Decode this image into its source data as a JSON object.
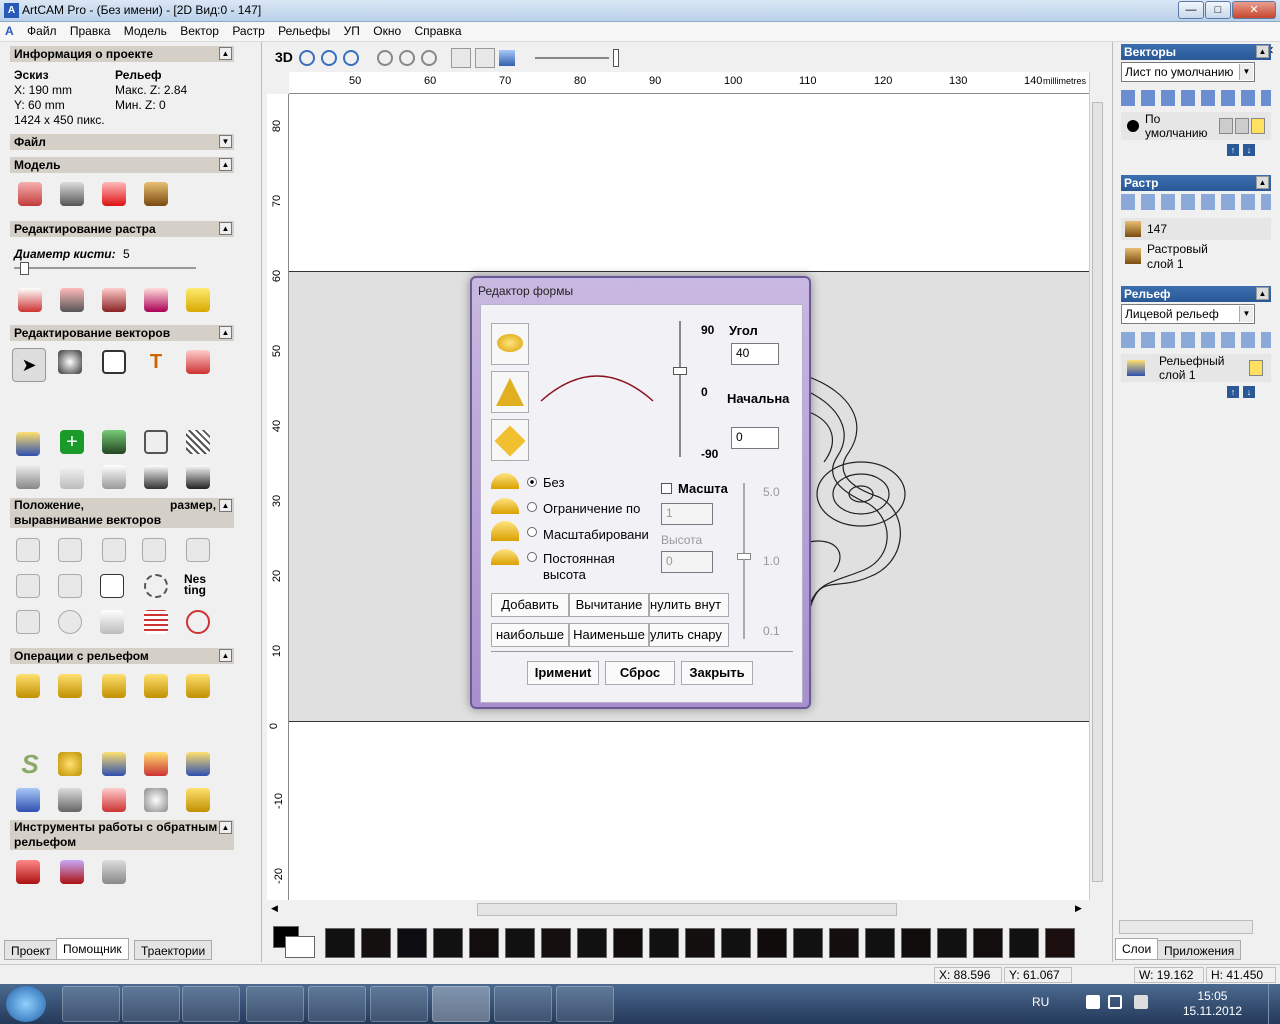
{
  "window": {
    "title": "ArtCAM Pro - (Без имени) - [2D Вид:0 - 147]",
    "btn_min": "—",
    "btn_max": "□",
    "btn_close": "✕"
  },
  "menu": [
    "Файл",
    "Правка",
    "Модель",
    "Вектор",
    "Растр",
    "Рельефы",
    "УП",
    "Окно",
    "Справка"
  ],
  "project_info": {
    "header": "Информация о проекте",
    "sketch_label": "Эскиз",
    "x": "X: 190 mm",
    "y": "Y: 60 mm",
    "pixels": "1424 x 450 пикс.",
    "relief_label": "Рельеф",
    "max_z": "Макс. Z: 2.84",
    "min_z": "Мин. Z: 0"
  },
  "sections": {
    "file": "Файл",
    "model": "Модель",
    "raster_edit": "Редактирование растра",
    "brush_label": "Диаметр кисти:",
    "brush_value": "5",
    "vector_edit": "Редактирование векторов",
    "position_1": "Положение,",
    "position_2": "размер,",
    "position_3": "выравнивание векторов",
    "relief_ops": "Операции с рельефом",
    "reverse_1": "Инструменты работы с обратным",
    "reverse_2": "рельефом",
    "nesting_1": "Nes",
    "nesting_2": "ting"
  },
  "left_tabs": [
    "Проект",
    "Помощник",
    "Траектории"
  ],
  "view_toolbar": {
    "mode_3d": "3D"
  },
  "ruler": {
    "top_ticks": [
      "50",
      "60",
      "70",
      "80",
      "90",
      "100",
      "110",
      "120",
      "130",
      "140"
    ],
    "top_unit": "millimetres",
    "left_ticks": [
      "80",
      "70",
      "60",
      "50",
      "40",
      "30",
      "20",
      "10",
      "0",
      "-10",
      "-20"
    ]
  },
  "right_panel": {
    "vectors_header": "Векторы",
    "vectors_combo": "Лист по умолчанию",
    "vector_layer_1": "По",
    "vector_layer_2": "умолчанию",
    "raster_header": "Растр",
    "raster_item_1": "147",
    "raster_item_2a": "Растровый",
    "raster_item_2b": "слой 1",
    "relief_header": "Рельеф",
    "relief_combo": "Лицевой рельеф",
    "relief_layer_1": "Рельефный",
    "relief_layer_2": "слой 1",
    "tabs": [
      "Слои",
      "Приложения"
    ]
  },
  "dialog": {
    "title": "Редактор формы",
    "angle_label": "Угол",
    "angle_value": "40",
    "start_label": "Начальна",
    "start_value": "0",
    "slider_top": "90",
    "slider_mid": "0",
    "slider_bottom": "-90",
    "radio_none": "Без",
    "radio_limit": "Ограничение по",
    "radio_scale": "Масштабировани",
    "radio_const_1": "Постоянная",
    "radio_const_2": "высота",
    "check_scale": "Масшта",
    "scale_value": "1",
    "height_label": "Высота",
    "height_value": "0",
    "vslider_top": "5.0",
    "vslider_mid": "1.0",
    "vslider_bottom": "0.1",
    "btn_add": "Добавить",
    "btn_subtract": "Вычитание",
    "btn_zero_in": "нулить внут",
    "btn_max": "наибольше",
    "btn_min": "Наименьше",
    "btn_zero_out": "улить снару",
    "btn_apply": "Iримениt",
    "btn_reset": "Сброс",
    "btn_close": "Закрыть"
  },
  "status": {
    "x": "X: 88.596",
    "y": "Y: 61.067",
    "w": "W: 19.162",
    "h": "H: 41.450"
  },
  "taskbar": {
    "lang": "RU",
    "time": "15:05",
    "date": "15.11.2012"
  },
  "colors": {
    "relief_bg": "#e0e0e0",
    "dialog_frame": "#a88fcc",
    "right_header": "#2b5896",
    "taskbar": "#23395a"
  }
}
